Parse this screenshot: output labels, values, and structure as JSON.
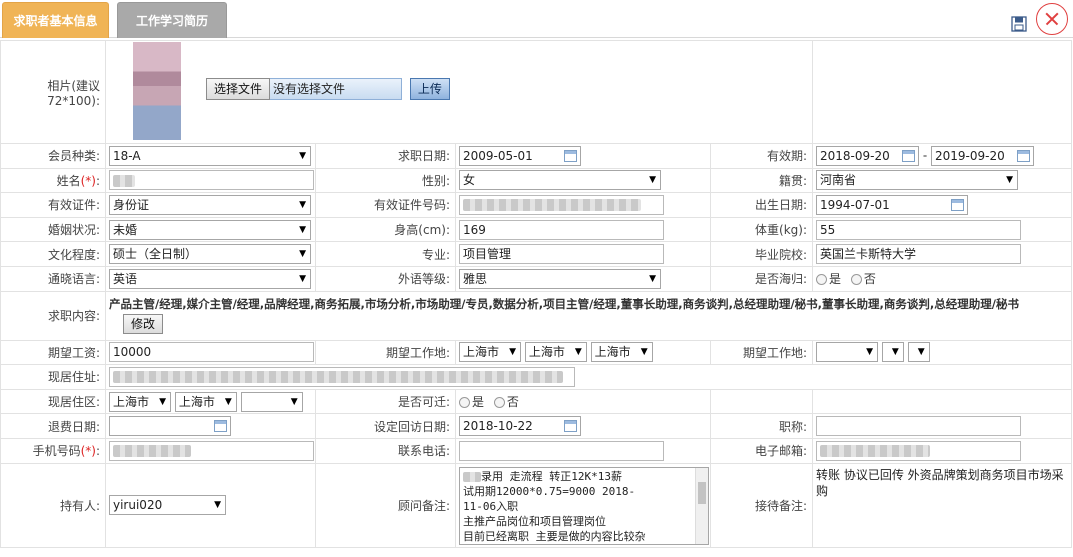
{
  "tabs": [
    {
      "label": "求职者基本信息"
    },
    {
      "label": "工作学习简历"
    }
  ],
  "photo": {
    "label": "相片(建议72*100):",
    "choose_button": "选择文件",
    "no_file_text": "没有选择文件",
    "upload_button": "上传"
  },
  "row1": {
    "member_type_label": "会员种类:",
    "member_type_value": "18-A",
    "apply_date_label": "求职日期:",
    "apply_date_value": "2009-05-01",
    "valid_period_label": "有效期:",
    "valid_from": "2018-09-20",
    "valid_sep": "-",
    "valid_to": "2019-09-20"
  },
  "row2": {
    "name_label": "姓名",
    "required_mark": "(*)",
    "name_colon": ":",
    "gender_label": "性别:",
    "gender_value": "女",
    "origin_label": "籍贯:",
    "origin_value": "河南省"
  },
  "row3": {
    "id_type_label": "有效证件:",
    "id_type_value": "身份证",
    "id_number_label": "有效证件号码:",
    "birth_label": "出生日期:",
    "birth_value": "1994-07-01"
  },
  "row4": {
    "marital_label": "婚姻状况:",
    "marital_value": "未婚",
    "height_label": "身高(cm):",
    "height_value": "169",
    "weight_label": "体重(kg):",
    "weight_value": "55"
  },
  "row5": {
    "edu_label": "文化程度:",
    "edu_value": "硕士（全日制）",
    "major_label": "专业:",
    "major_value": "项目管理",
    "school_label": "毕业院校:",
    "school_value": "英国兰卡斯特大学"
  },
  "row6": {
    "lang_label": "通晓语言:",
    "lang_value": "英语",
    "lang_level_label": "外语等级:",
    "lang_level_value": "雅思",
    "overseas_label": "是否海归:",
    "yes": "是",
    "no": "否"
  },
  "row7": {
    "job_content_label": "求职内容:",
    "job_content_value": "产品主管/经理,媒介主管/经理,品牌经理,商务拓展,市场分析,市场助理/专员,数据分析,项目主管/经理,董事长助理,商务谈判,总经理助理/秘书,董事长助理,商务谈判,总经理助理/秘书",
    "modify_button": "修改"
  },
  "row8": {
    "salary_label": "期望工资:",
    "salary_value": "10000",
    "work_place_label": "期望工作地:",
    "wp1": "上海市",
    "wp2": "上海市",
    "wp3": "上海市",
    "work_place2_label": "期望工作地:"
  },
  "row9": {
    "address_label": "现居住址:"
  },
  "row10": {
    "district_label": "现居住区:",
    "d1": "上海市",
    "d2": "上海市",
    "relocate_label": "是否可迁:",
    "yes": "是",
    "no": "否"
  },
  "row11": {
    "refund_label": "退费日期:",
    "revisit_label": "设定回访日期:",
    "revisit_value": "2018-10-22",
    "title_label": "职称:"
  },
  "row12": {
    "mobile_label": "手机号码",
    "required_mark": "(*)",
    "mobile_colon": ":",
    "phone_label": "联系电话:",
    "email_label": "电子邮箱:"
  },
  "row13": {
    "holder_label": "持有人:",
    "holder_value": "yirui020",
    "consultant_note_label": "顾问备注:",
    "consultant_note_lines": [
      "录用  走流程   转正12K*13薪",
      "试用期12000*0.75=9000  2018-",
      "11-06入职",
      "主推产品岗位和项目管理岗位",
      "目前已经离职  主要是做的内容比较杂"
    ],
    "reception_note_label": "接待备注:",
    "reception_note_value": "转账 协议已回传 外资品牌策划商务项目市场采购"
  }
}
